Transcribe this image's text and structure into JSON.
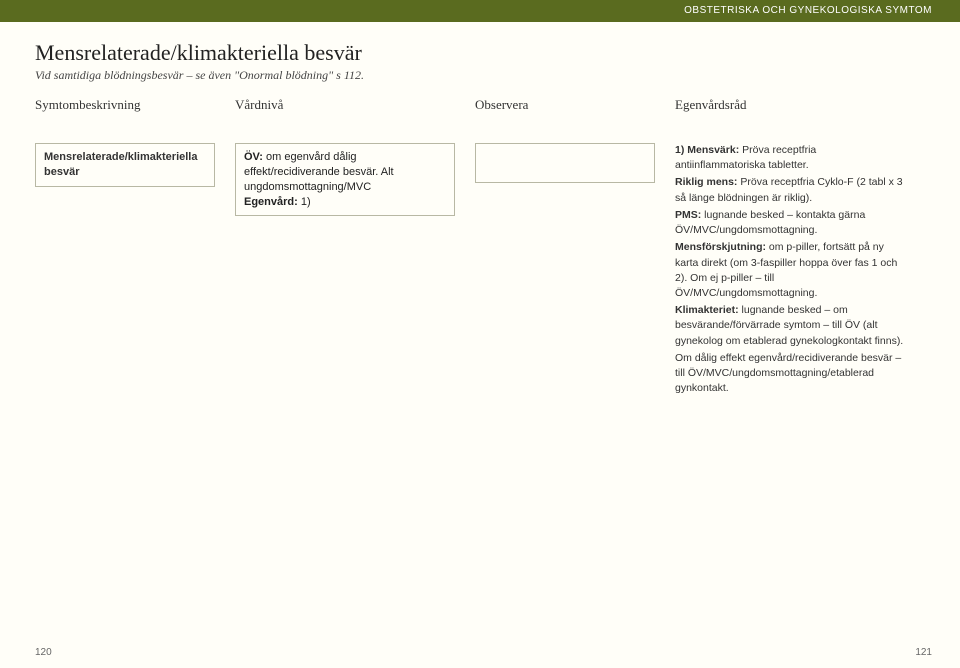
{
  "header": {
    "category": "OBSTETRISKA OCH GYNEKOLOGISKA SYMTOM"
  },
  "title": {
    "main": "Mensrelaterade/klimakteriella besvär",
    "sub": "Vid samtidiga blödningsbesvär – se även \"Onormal blödning\" s 112."
  },
  "columns": {
    "c1": "Symtombeskrivning",
    "c2": "Vårdnivå",
    "c3": "Observera",
    "c4": "Egenvårdsråd"
  },
  "row": {
    "symptom": "Mensrelaterade/klimakteriella besvär",
    "care_bold_label": "ÖV:",
    "care_line1": " om egenvård dålig effekt/recidiverande besvär. Alt ungdomsmottagning/MVC",
    "care_line2_bold": "Egenvård:",
    "care_line2_rest": " 1)",
    "observe": ""
  },
  "advice": {
    "p1_b": "1) Mensvärk:",
    "p1_r": " Pröva receptfria antiinflammatoriska tabletter.",
    "p2_b": "Riklig mens:",
    "p2_r": " Pröva receptfria Cyklo-F (2 tabl x 3 så länge blödningen är riklig).",
    "p3_b": "PMS:",
    "p3_r": " lugnande besked – kontakta gärna ÖV/MVC/ungdomsmottagning.",
    "p4_b": "Mensförskjutning:",
    "p4_r": " om p-piller, fortsätt på ny karta direkt (om 3-faspiller hoppa över fas 1 och 2). Om ej p-piller – till ÖV/MVC/ungdomsmottagning.",
    "p5_b": "Klimakteriet:",
    "p5_r": " lugnande besked – om besvärande/förvärrade symtom – till ÖV (alt gynekolog om etablerad gynekologkontakt finns).",
    "p6": "Om dålig effekt egenvård/recidiverande besvär – till ÖV/MVC/ungdomsmottagning/etablerad gynkontakt."
  },
  "pagenum": {
    "left": "120",
    "right": "121"
  }
}
